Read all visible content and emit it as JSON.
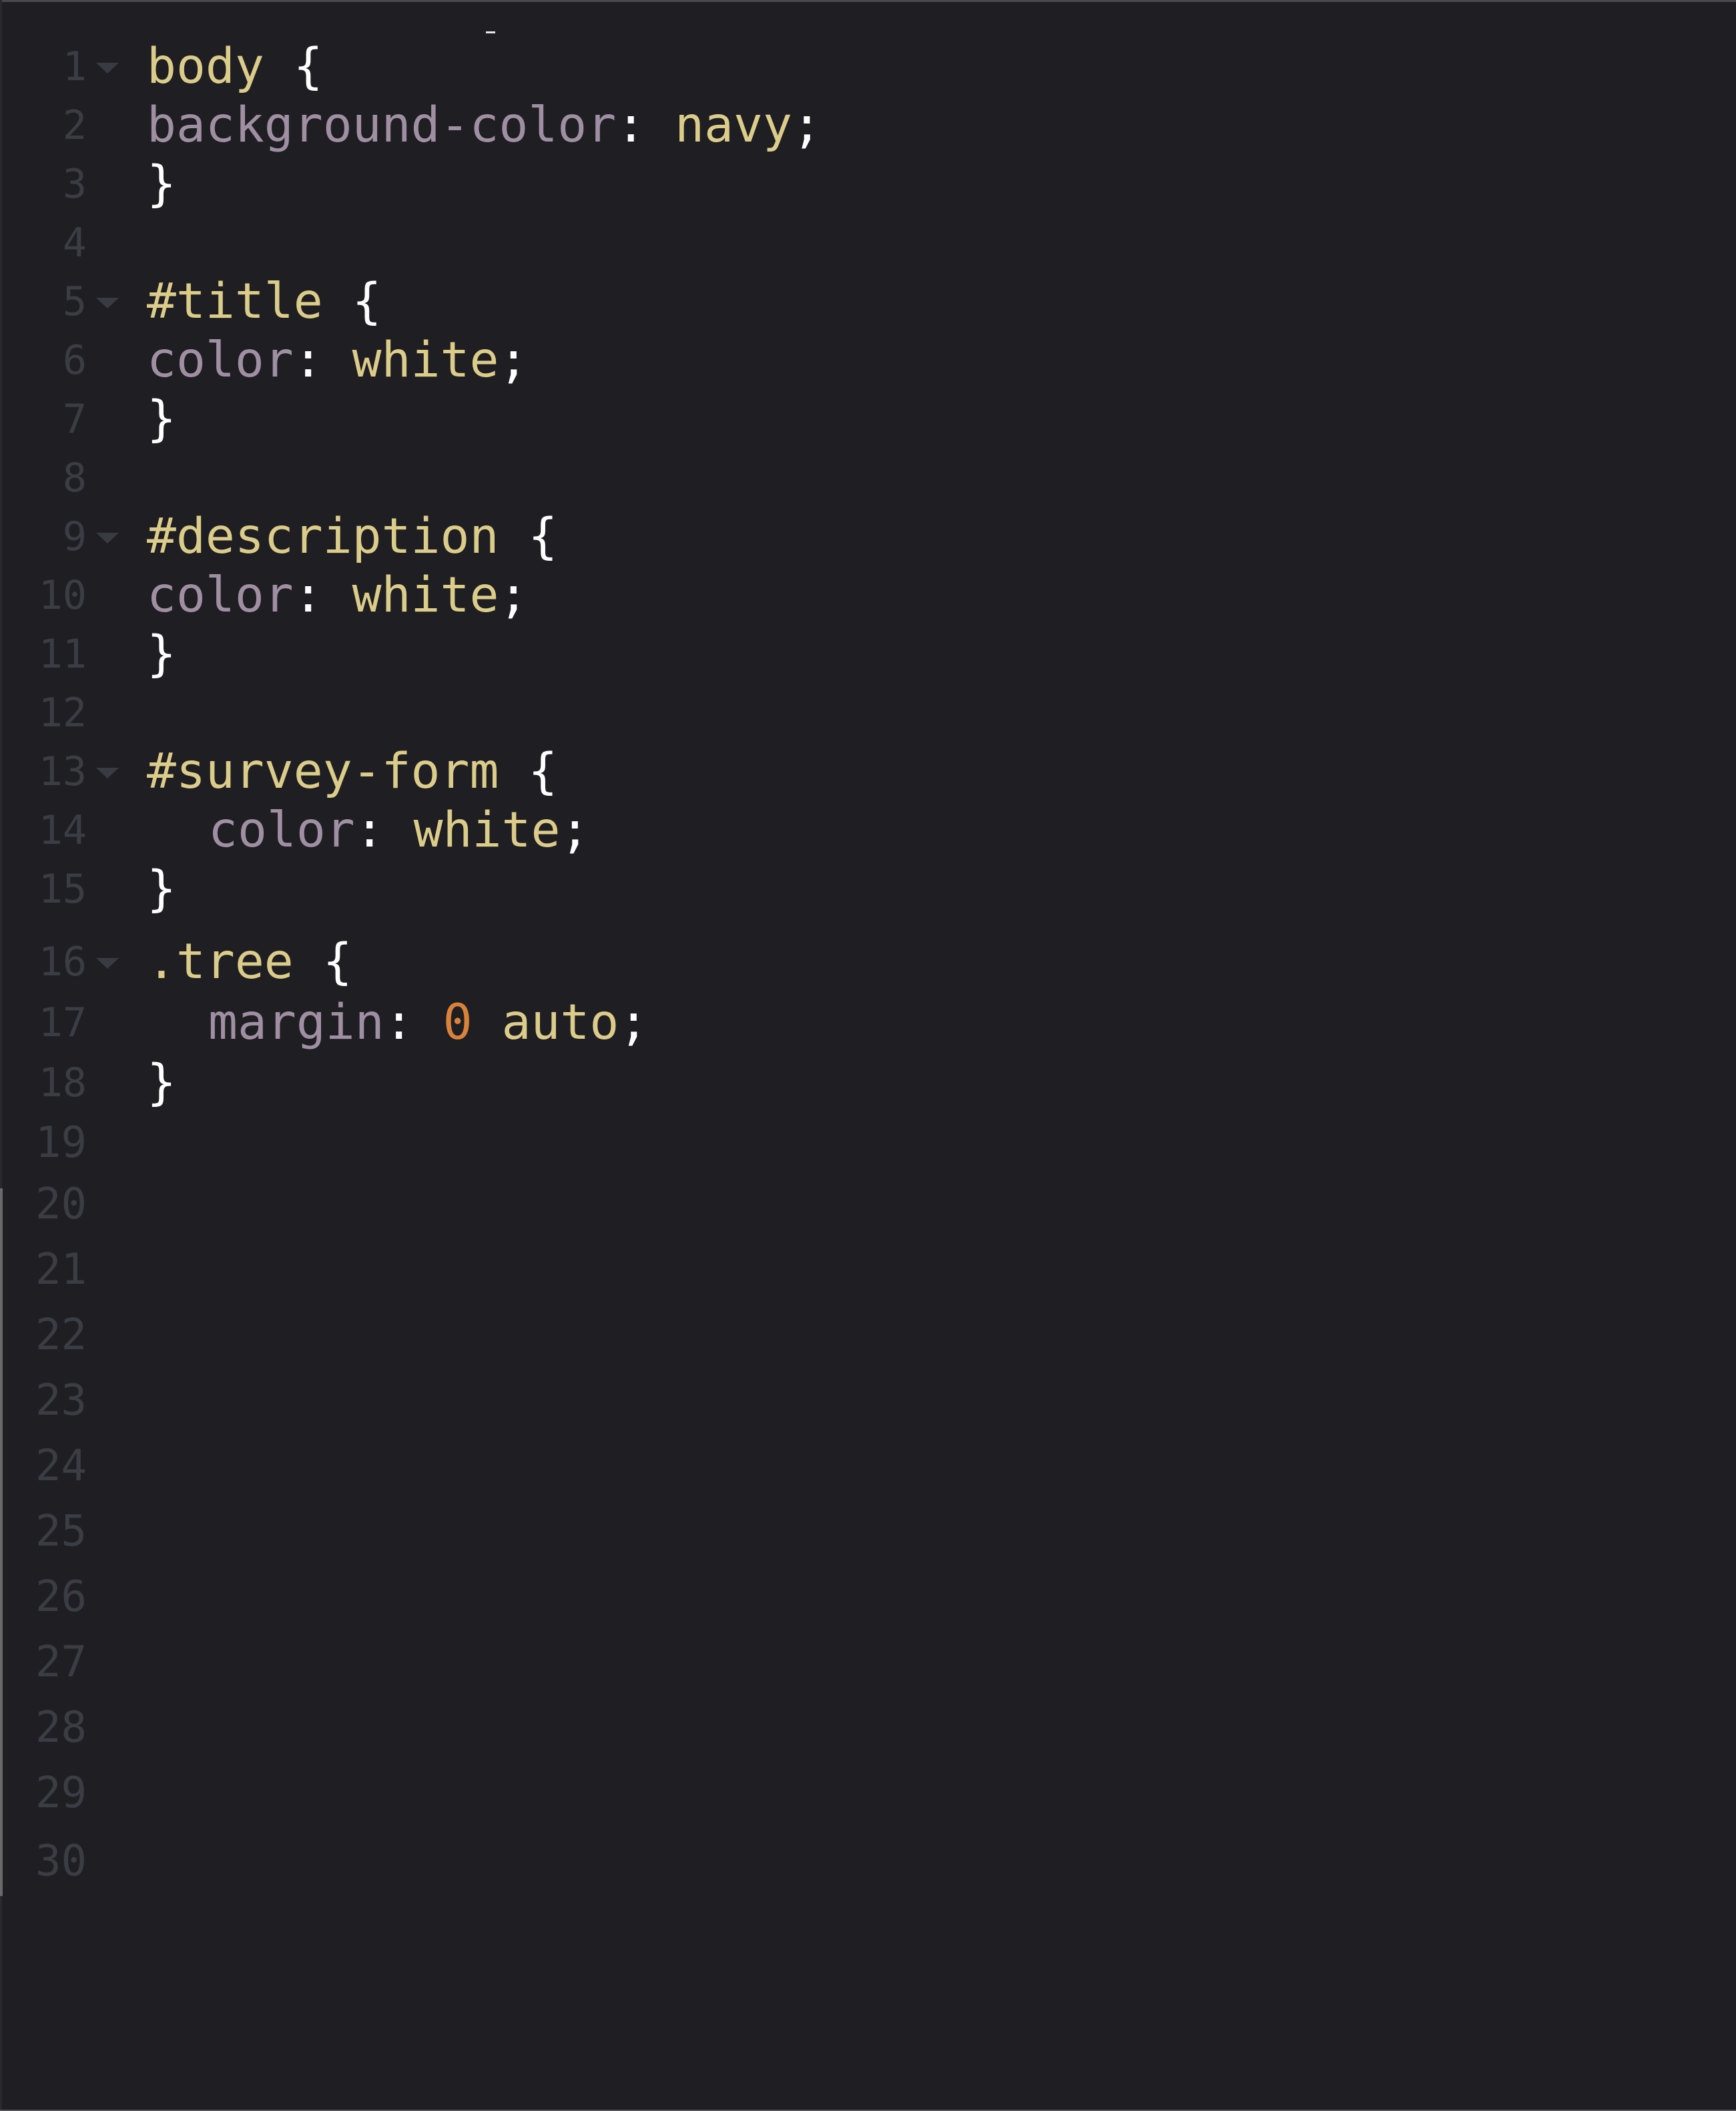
{
  "editor": {
    "language": "css",
    "lines": [
      {
        "n": "1",
        "foldable": true,
        "indent": false,
        "tokens": [
          {
            "t": "sel",
            "v": "body"
          },
          {
            "t": "punc",
            "v": " {"
          }
        ]
      },
      {
        "n": "2",
        "foldable": false,
        "indent": false,
        "tokens": [
          {
            "t": "prop",
            "v": "background-color"
          },
          {
            "t": "punc",
            "v": ": "
          },
          {
            "t": "val",
            "v": "navy"
          },
          {
            "t": "punc",
            "v": ";"
          }
        ]
      },
      {
        "n": "3",
        "foldable": false,
        "indent": false,
        "tokens": [
          {
            "t": "punc",
            "v": "}"
          }
        ]
      },
      {
        "n": "4",
        "foldable": false,
        "indent": false,
        "tokens": []
      },
      {
        "n": "5",
        "foldable": true,
        "indent": false,
        "tokens": [
          {
            "t": "sel",
            "v": "#title"
          },
          {
            "t": "punc",
            "v": " {"
          }
        ]
      },
      {
        "n": "6",
        "foldable": false,
        "indent": false,
        "tokens": [
          {
            "t": "prop",
            "v": "color"
          },
          {
            "t": "punc",
            "v": ": "
          },
          {
            "t": "val",
            "v": "white"
          },
          {
            "t": "punc",
            "v": ";"
          }
        ]
      },
      {
        "n": "7",
        "foldable": false,
        "indent": false,
        "tokens": [
          {
            "t": "punc",
            "v": "}"
          }
        ]
      },
      {
        "n": "8",
        "foldable": false,
        "indent": false,
        "tokens": []
      },
      {
        "n": "9",
        "foldable": true,
        "indent": false,
        "tokens": [
          {
            "t": "sel",
            "v": "#description"
          },
          {
            "t": "punc",
            "v": " {"
          }
        ]
      },
      {
        "n": "10",
        "foldable": false,
        "indent": false,
        "tokens": [
          {
            "t": "prop",
            "v": "color"
          },
          {
            "t": "punc",
            "v": ": "
          },
          {
            "t": "val",
            "v": "white"
          },
          {
            "t": "punc",
            "v": ";"
          }
        ]
      },
      {
        "n": "11",
        "foldable": false,
        "indent": false,
        "tokens": [
          {
            "t": "punc",
            "v": "}"
          }
        ]
      },
      {
        "n": "12",
        "foldable": false,
        "indent": false,
        "tokens": []
      },
      {
        "n": "13",
        "foldable": true,
        "indent": false,
        "tokens": [
          {
            "t": "sel",
            "v": "#survey-form"
          },
          {
            "t": "punc",
            "v": " {"
          }
        ]
      },
      {
        "n": "14",
        "foldable": false,
        "indent": true,
        "tokens": [
          {
            "t": "prop",
            "v": "color"
          },
          {
            "t": "punc",
            "v": ": "
          },
          {
            "t": "val",
            "v": "white"
          },
          {
            "t": "punc",
            "v": ";"
          }
        ]
      },
      {
        "n": "15",
        "foldable": false,
        "indent": false,
        "tokens": [
          {
            "t": "punc",
            "v": "}"
          }
        ]
      },
      {
        "n": "16",
        "foldable": true,
        "indent": false,
        "tokens": [
          {
            "t": "sel",
            "v": ".tree"
          },
          {
            "t": "punc",
            "v": " {"
          }
        ]
      },
      {
        "n": "17",
        "foldable": false,
        "indent": true,
        "tokens": [
          {
            "t": "prop",
            "v": "margin"
          },
          {
            "t": "punc",
            "v": ": "
          },
          {
            "t": "num",
            "v": "0"
          },
          {
            "t": "punc",
            "v": " "
          },
          {
            "t": "val",
            "v": "auto"
          },
          {
            "t": "punc",
            "v": ";"
          }
        ]
      },
      {
        "n": "18",
        "foldable": false,
        "indent": false,
        "tokens": [
          {
            "t": "punc",
            "v": "}"
          }
        ]
      },
      {
        "n": "19",
        "foldable": false,
        "indent": false,
        "tokens": []
      },
      {
        "n": "20",
        "foldable": false,
        "indent": false,
        "tokens": []
      },
      {
        "n": "21",
        "foldable": false,
        "indent": false,
        "tokens": []
      },
      {
        "n": "22",
        "foldable": false,
        "indent": false,
        "tokens": []
      },
      {
        "n": "23",
        "foldable": false,
        "indent": false,
        "tokens": []
      },
      {
        "n": "24",
        "foldable": false,
        "indent": false,
        "tokens": []
      },
      {
        "n": "25",
        "foldable": false,
        "indent": false,
        "tokens": []
      },
      {
        "n": "26",
        "foldable": false,
        "indent": false,
        "tokens": []
      },
      {
        "n": "27",
        "foldable": false,
        "indent": false,
        "tokens": []
      },
      {
        "n": "28",
        "foldable": false,
        "indent": false,
        "tokens": []
      },
      {
        "n": "29",
        "foldable": false,
        "indent": false,
        "tokens": []
      },
      {
        "n": "30",
        "foldable": false,
        "indent": false,
        "tokens": []
      }
    ]
  },
  "colors": {
    "background": "#1f1f23",
    "gutter_text": "#3a3d44",
    "selector": "#dccc8a",
    "property": "#a08fa3",
    "value": "#dccc8a",
    "number": "#d8823a",
    "punctuation": "#ffffff"
  },
  "icons": {
    "fold": "fold-arrow-icon"
  }
}
